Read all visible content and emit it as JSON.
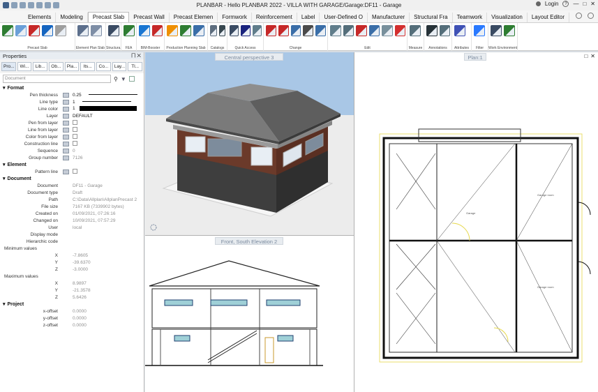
{
  "window": {
    "title": "PLANBAR - Hello PLANBAR 2022 - VILLA WITH GARAGE/Garage:DF11 - Garage",
    "login_label": "Login",
    "help_glyph": "?",
    "icons": [
      "undo-icon",
      "redo-icon",
      "gear-icon",
      "help-icon"
    ]
  },
  "ribbon": {
    "tabs": [
      "Elements",
      "Modeling",
      "Precast Slab",
      "Precast Wall",
      "Precast Elemen",
      "Formwork",
      "Reinforcement",
      "Label",
      "User-Defined O",
      "Manufacturer",
      "Structural Fra",
      "Teamwork",
      "Visualization",
      "Layout Editor"
    ],
    "active_tab_index": 2,
    "groups": [
      {
        "label": "Precast Slab",
        "icon_colors": [
          "#2e7d32",
          "#6a9fd8",
          "#c62828",
          "#1565c0",
          "#9e9e9e"
        ]
      },
      {
        "label": "Element Plan Slab",
        "icon_colors": [
          "#5c6f8c",
          "#7e8ea6"
        ]
      },
      {
        "label": "Structura...",
        "icon_colors": [
          "#3a4b63"
        ]
      },
      {
        "label": "FEA",
        "icon_colors": [
          "#2e7d32"
        ]
      },
      {
        "label": "BIM-Booster",
        "icon_colors": [
          "#1976d2",
          "#c62828"
        ]
      },
      {
        "label": "Production Planning Slab",
        "icon_colors": [
          "#ef8f00",
          "#2e7d32",
          "#3a6ea8"
        ]
      },
      {
        "label": "Catalogs",
        "icon_colors": [
          "#5d6d7e",
          "#37474f"
        ]
      },
      {
        "label": "Quick Access",
        "icon_colors": [
          "#3a4b63",
          "#1a237e",
          "#607d8b"
        ]
      },
      {
        "label": "Change",
        "icon_colors": [
          "#c62828",
          "#c62828",
          "#3a6ea8",
          "#4a4a4a",
          "#3a6ea8"
        ]
      },
      {
        "label": "Edit",
        "icon_colors": [
          "#607d8b",
          "#546e7a",
          "#c62828",
          "#3a6ea8",
          "#78909c",
          "#d32f2f"
        ]
      },
      {
        "label": "Measure",
        "icon_colors": [
          "#546e7a"
        ]
      },
      {
        "label": "Annotations",
        "icon_colors": [
          "#263238",
          "#546e7a"
        ]
      },
      {
        "label": "Attributes",
        "icon_colors": [
          "#3f51b5"
        ]
      },
      {
        "label": "Filter",
        "icon_colors": [
          "#2979ff"
        ]
      },
      {
        "label": "Work Environment",
        "icon_colors": [
          "#3a4b63",
          "#2e7d32"
        ]
      }
    ]
  },
  "properties": {
    "panel_title": "Properties",
    "pin_glyph": "⨅ ✕",
    "tabs": [
      "Pro...",
      "Wi...",
      "Lib...",
      "Ob...",
      "Pla...",
      "Its...",
      "Co...",
      "Lay...",
      "Tl..."
    ],
    "filter_placeholder": "Document",
    "sections": [
      {
        "title": "Format",
        "rows": [
          {
            "label": "Pen thickness",
            "value": "0.25",
            "kind": "line"
          },
          {
            "label": "Line type",
            "value": "1",
            "kind": "line"
          },
          {
            "label": "Line color",
            "value": "1",
            "kind": "color"
          },
          {
            "label": "Layer",
            "value": "DEFAULT",
            "kind": "text"
          },
          {
            "label": "Pen from layer",
            "value": "",
            "kind": "check"
          },
          {
            "label": "Line from layer",
            "value": "",
            "kind": "check"
          },
          {
            "label": "Color from layer",
            "value": "",
            "kind": "check"
          },
          {
            "label": "Construction line",
            "value": "",
            "kind": "check"
          },
          {
            "label": "Sequence",
            "value": "0",
            "kind": "grey"
          },
          {
            "label": "Group number",
            "value": "7126",
            "kind": "grey"
          }
        ]
      },
      {
        "title": "Element",
        "rows": [
          {
            "label": "Pattern line",
            "value": "",
            "kind": "check"
          }
        ]
      },
      {
        "title": "Document",
        "rows": [
          {
            "label": "Document",
            "value": "DF11 - Garage",
            "kind": "grey"
          },
          {
            "label": "Document type",
            "value": "Draft",
            "kind": "grey"
          },
          {
            "label": "Path",
            "value": "C:\\Data\\Allplan\\AllplanPrecast 2",
            "kind": "grey"
          },
          {
            "label": "File size",
            "value": "7167 KB (7339902 bytes)",
            "kind": "grey"
          },
          {
            "label": "Created on",
            "value": "01/09/2021, 07:26:16",
            "kind": "grey"
          },
          {
            "label": "Changed on",
            "value": "10/09/2021, 07:57:29",
            "kind": "grey"
          },
          {
            "label": "User",
            "value": "local",
            "kind": "grey"
          },
          {
            "label": "Display mode",
            "value": "",
            "kind": "grey"
          },
          {
            "label": "Hierarchic code",
            "value": "",
            "kind": "grey"
          },
          {
            "label": "Minimum values",
            "value": "",
            "kind": "sub"
          },
          {
            "label": "X",
            "value": "-7.8605",
            "kind": "grey"
          },
          {
            "label": "Y",
            "value": "-39.6370",
            "kind": "grey"
          },
          {
            "label": "Z",
            "value": "-3.0000",
            "kind": "grey"
          },
          {
            "label": "Maximum values",
            "value": "",
            "kind": "sub"
          },
          {
            "label": "X",
            "value": "8.9897",
            "kind": "grey"
          },
          {
            "label": "Y",
            "value": "-21.3578",
            "kind": "grey"
          },
          {
            "label": "Z",
            "value": "5.6426",
            "kind": "grey"
          }
        ]
      },
      {
        "title": "Project",
        "rows": [
          {
            "label": "x-offset",
            "value": "0.0000",
            "kind": "grey"
          },
          {
            "label": "y-offset",
            "value": "0.0000",
            "kind": "grey"
          },
          {
            "label": "z-offset",
            "value": "0.0000",
            "kind": "grey"
          }
        ]
      }
    ]
  },
  "views": {
    "perspective_title": "Central perspective 3",
    "elevation_title": "Front, South Elevation 2",
    "plan_title": "Plan:1",
    "plan_labels": [
      "Garage",
      "Garage room",
      "Garage room"
    ],
    "colors": {
      "roof": "#7a7a7a",
      "brick": "#6b3a2a",
      "sky": "#a9c7e6",
      "ground": "#ececec",
      "plan_accent": "#e6d84a"
    }
  }
}
